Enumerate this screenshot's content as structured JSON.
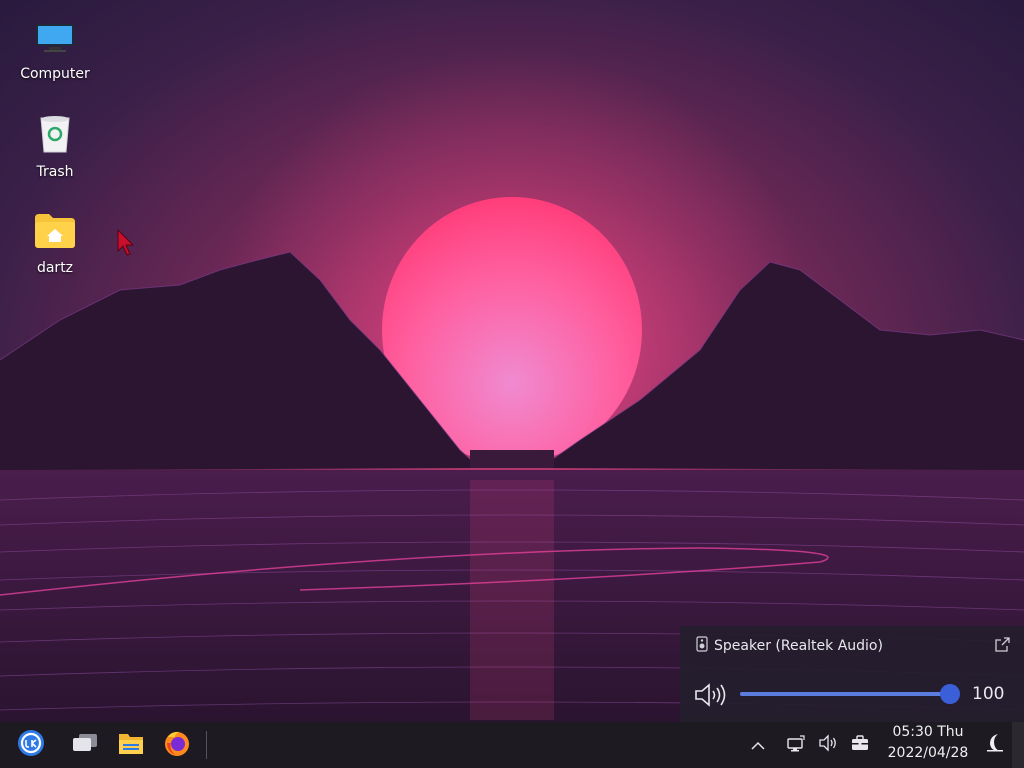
{
  "desktop": {
    "icons": [
      {
        "label": "Computer",
        "icon": "monitor-icon"
      },
      {
        "label": "Trash",
        "icon": "trash-icon"
      },
      {
        "label": "dartz",
        "icon": "home-folder-icon"
      }
    ]
  },
  "volume_popup": {
    "device_label": "Speaker (Realtek Audio)",
    "volume_value": "100",
    "volume_level": 1.0,
    "accent": "#3a5fd8"
  },
  "taskbar": {
    "launchers": [
      "start-menu-icon",
      "multitasking-view-icon",
      "file-manager-icon",
      "firefox-icon"
    ],
    "tray": [
      "show-hidden-icons-chevron",
      "network-icon",
      "volume-icon",
      "toolbox-icon"
    ],
    "clock_time": "05:30 Thu",
    "clock_date": "2022/04/28",
    "night_mode_icon": "moon-icon"
  },
  "colors": {
    "taskbar_bg": "#1d1a22",
    "sun": "#ff6aa8",
    "wallpaper_sky": "#3a1f48"
  }
}
